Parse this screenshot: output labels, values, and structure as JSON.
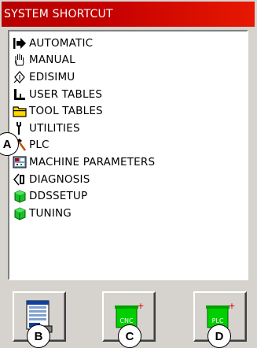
{
  "window": {
    "title": "SYSTEM SHORTCUT"
  },
  "menu": {
    "items": [
      {
        "label": "AUTOMATIC",
        "icon": "arrow-right-icon"
      },
      {
        "label": "MANUAL",
        "icon": "hand-icon"
      },
      {
        "label": "EDISIMU",
        "icon": "diamond-icon"
      },
      {
        "label": "USER TABLES",
        "icon": "axes-icon"
      },
      {
        "label": "TOOL TABLES",
        "icon": "folder-icon"
      },
      {
        "label": "UTILITIES",
        "icon": "wrench-icon"
      },
      {
        "label": "PLC",
        "icon": "hammer-icon"
      },
      {
        "label": "MACHINE PARAMETERS",
        "icon": "machine-icon"
      },
      {
        "label": "DIAGNOSIS",
        "icon": "diagnosis-icon"
      },
      {
        "label": "DDSSETUP",
        "icon": "green-cube-icon"
      },
      {
        "label": "TUNING",
        "icon": "green-cube-icon"
      }
    ]
  },
  "buttons": {
    "b": {
      "icon": "table-window-icon"
    },
    "c": {
      "label": "CNC",
      "icon": "cnc-icon"
    },
    "d": {
      "label": "PLC",
      "icon": "plc-icon"
    }
  },
  "callouts": {
    "a": "A",
    "b": "B",
    "c": "C",
    "d": "D"
  }
}
